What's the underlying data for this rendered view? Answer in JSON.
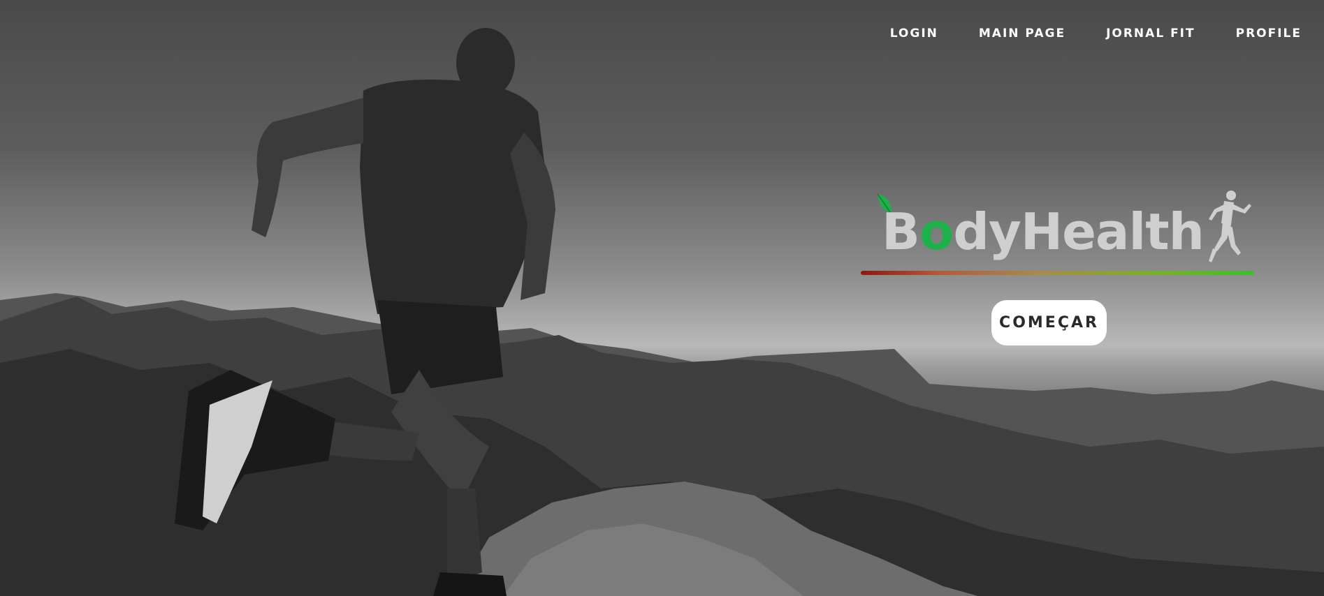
{
  "nav": {
    "items": [
      {
        "label": "LOGIN"
      },
      {
        "label": "MAIN PAGE"
      },
      {
        "label": "JORNAL FIT"
      },
      {
        "label": "PROFILE"
      }
    ]
  },
  "brand": {
    "first_letter": "B",
    "accent_letter": "o",
    "rest": "dyHealth",
    "accent_color": "#1eb04a"
  },
  "hero": {
    "cta_label": "COMEÇAR",
    "background_image": "black-and-white photo of a runner on a mountain ridge"
  },
  "icons": [
    "leaf-icon",
    "runner-icon"
  ]
}
